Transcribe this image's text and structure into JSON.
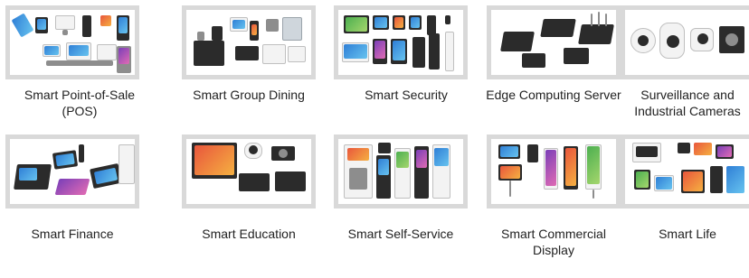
{
  "categories": [
    {
      "label": "Smart Point-of-Sale (POS)",
      "icon": "pos-terminals-image"
    },
    {
      "label": "Smart Group Dining",
      "icon": "group-dining-devices-image"
    },
    {
      "label": "Smart Security",
      "icon": "security-terminals-image"
    },
    {
      "label": "Edge Computing Server",
      "icon": "edge-server-boxes-image"
    },
    {
      "label": "Surveillance and Industrial Cameras",
      "icon": "cameras-image"
    },
    {
      "label": "Smart Finance",
      "icon": "finance-terminals-image"
    },
    {
      "label": "Smart Education",
      "icon": "education-devices-image"
    },
    {
      "label": "Smart Self-Service",
      "icon": "self-service-kiosks-image"
    },
    {
      "label": "Smart Commercial Display",
      "icon": "commercial-display-image"
    },
    {
      "label": "Smart Life",
      "icon": "smart-life-devices-image"
    }
  ],
  "colors": {
    "frame_border": "#d9d9d9",
    "text": "#222222",
    "background": "#ffffff"
  }
}
